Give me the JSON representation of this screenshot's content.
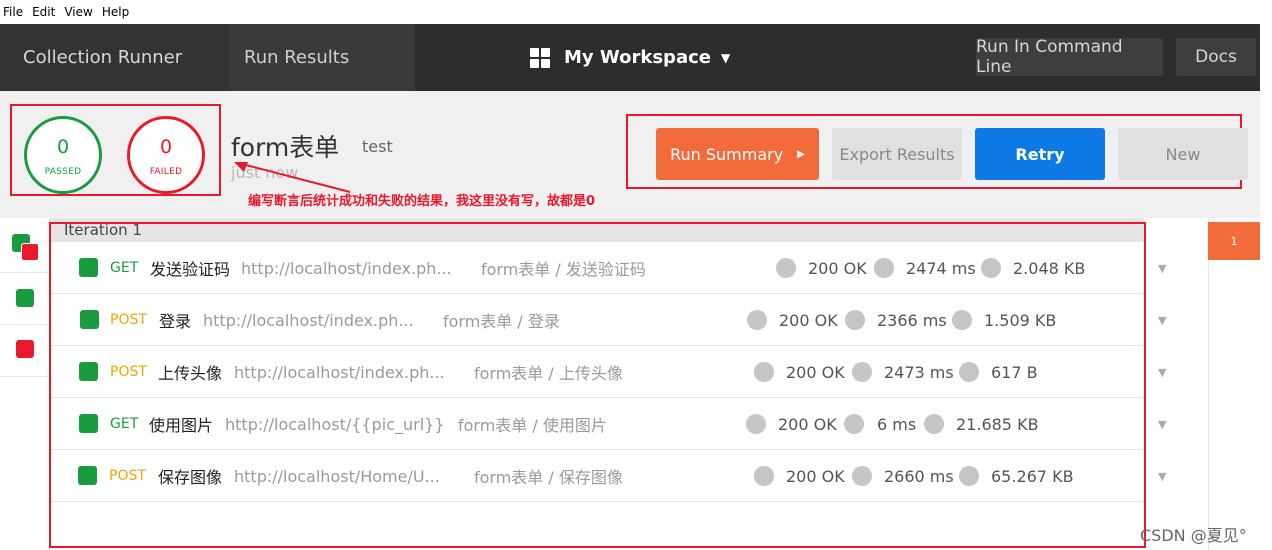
{
  "menu": [
    "File",
    "Edit",
    "View",
    "Help"
  ],
  "header": {
    "crumb_runner": "Collection Runner",
    "crumb_results": "Run Results",
    "workspace": "My Workspace",
    "run_cli": "Run In Command Line",
    "docs": "Docs"
  },
  "summary": {
    "passed_count": "0",
    "passed_label": "PASSED",
    "failed_count": "0",
    "failed_label": "FAILED",
    "title": "form表单",
    "environment": "test",
    "time": "just now",
    "annotation": "编写断言后统计成功和失败的结果，我这里没有写，故都是0",
    "buttons": {
      "run_summary": "Run Summary",
      "export": "Export Results",
      "retry": "Retry",
      "new": "New"
    }
  },
  "iteration": {
    "label": "Iteration 1",
    "badge": "1"
  },
  "requests": [
    {
      "method": "GET",
      "name": "发送验证码",
      "url": "http://localhost/index.ph...",
      "path": "form表单 / 发送验证码",
      "status": "200 OK",
      "time": "2474 ms",
      "size": "2.048 KB"
    },
    {
      "method": "POST",
      "name": "登录",
      "url": "http://localhost/index.ph...",
      "path": "form表单 / 登录",
      "status": "200 OK",
      "time": "2366 ms",
      "size": "1.509 KB"
    },
    {
      "method": "POST",
      "name": "上传头像",
      "url": "http://localhost/index.ph...",
      "path": "form表单 / 上传头像",
      "status": "200 OK",
      "time": "2473 ms",
      "size": "617 B"
    },
    {
      "method": "GET",
      "name": "使用图片",
      "url": "http://localhost/{{pic_url}}",
      "path": "form表单 / 使用图片",
      "status": "200 OK",
      "time": "6 ms",
      "size": "21.685 KB"
    },
    {
      "method": "POST",
      "name": "保存图像",
      "url": "http://localhost/Home/U...",
      "path": "form表单 / 保存图像",
      "status": "200 OK",
      "time": "2660 ms",
      "size": "65.267 KB"
    }
  ],
  "watermark": "CSDN @夏见°",
  "colors": {
    "pass": "#1a9b3e",
    "fail": "#e8192c",
    "accent": "#f26b3a",
    "primary": "#0f7ae5",
    "get": "#1a9b3e",
    "post": "#f0a30a"
  }
}
